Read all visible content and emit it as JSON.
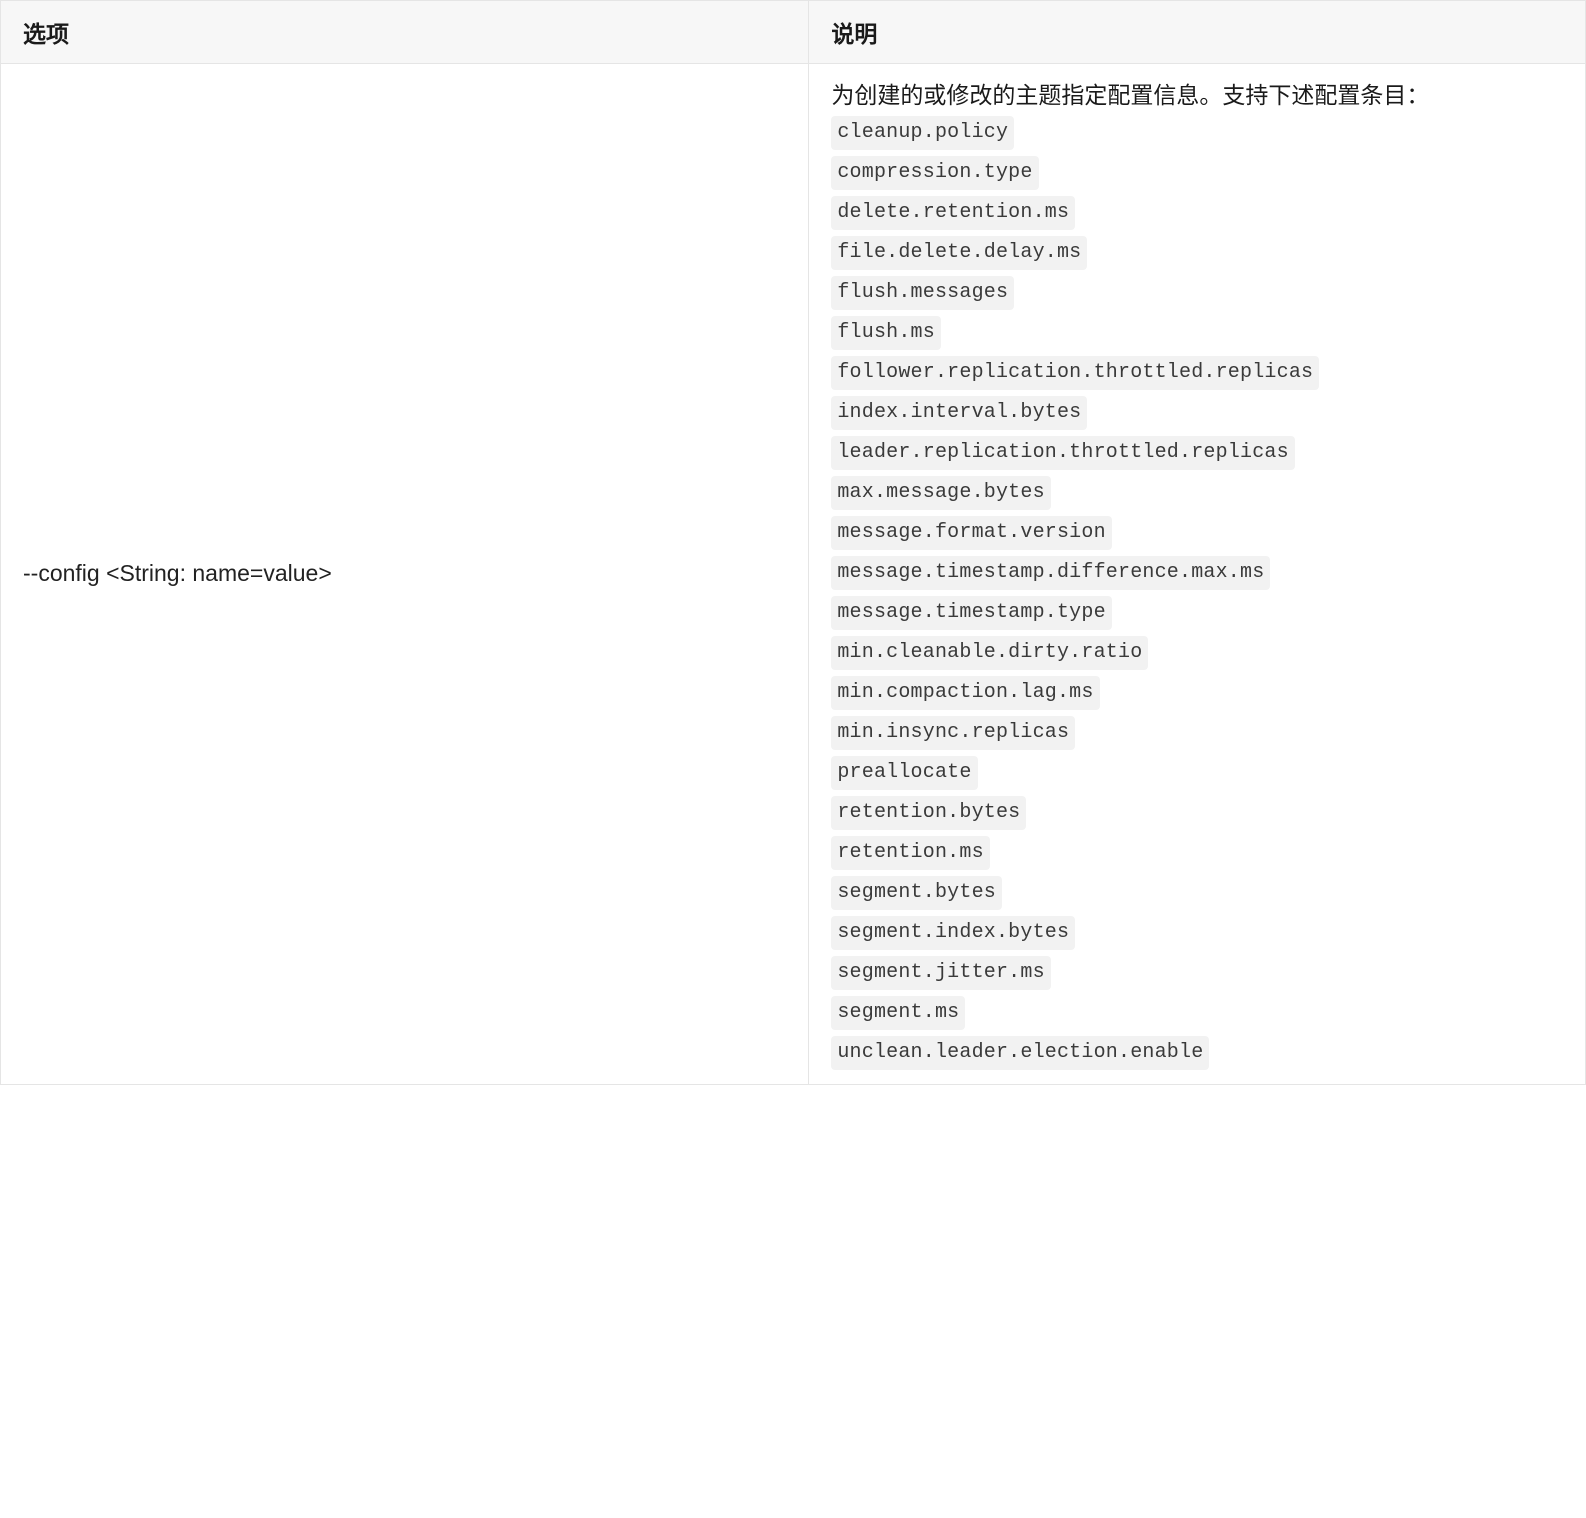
{
  "table": {
    "headers": {
      "option": "选项",
      "description": "说明"
    },
    "row": {
      "option": "--config <String: name=value>",
      "description_intro": "为创建的或修改的主题指定配置信息。支持下述配置条目：",
      "config_entries": [
        "cleanup.policy",
        "compression.type",
        "delete.retention.ms",
        "file.delete.delay.ms",
        "flush.messages",
        "flush.ms",
        "follower.replication.throttled.replicas",
        "index.interval.bytes",
        "leader.replication.throttled.replicas",
        "max.message.bytes",
        "message.format.version",
        "message.timestamp.difference.max.ms",
        "message.timestamp.type",
        "min.cleanable.dirty.ratio",
        "min.compaction.lag.ms",
        "min.insync.replicas",
        "preallocate",
        "retention.bytes",
        "retention.ms",
        "segment.bytes",
        "segment.index.bytes",
        "segment.jitter.ms",
        "segment.ms",
        "unclean.leader.election.enable"
      ]
    }
  }
}
